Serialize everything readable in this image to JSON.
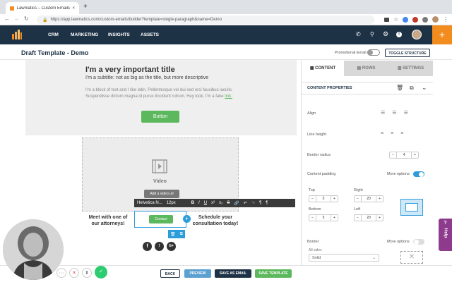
{
  "browser": {
    "tab_title": "Lawmatics – Custom Emails – B",
    "url": "https://app.lawmatics.com/custom-emails/builder?template=single-paragraph&name=Demo"
  },
  "nav": {
    "items": [
      "CRM",
      "MARKETING",
      "INSIGHTS",
      "ASSETS"
    ],
    "plus": "+"
  },
  "header": {
    "title": "Draft Template - Demo",
    "promotional_label": "Promotional Email",
    "toggle_structure": "TOGGLE STRUCTURE"
  },
  "email": {
    "title": "I'm a very important title",
    "subtitle": "I'm a subtitle: not as big as the title, but more descriptive",
    "body": "I'm a block of text and I like latin. Pellentesque vel dui sed orci faucibus iaculis. Suspendisse dictum magna id purus tincidunt rutrum. Hey look, I'm a fake",
    "link_text": "link.",
    "button": "Button",
    "video_label": "Video",
    "add_video": "Add a video url",
    "left_text": "Meet with one of our attorneys!",
    "right_text": "Schedule your consultation today!",
    "cta": "Contact"
  },
  "toolbar": {
    "font": "Helvetica N...",
    "size": "12px"
  },
  "panel": {
    "tabs": [
      "CONTENT",
      "ROWS",
      "SETTINGS"
    ],
    "section": "CONTENT PROPERTIES",
    "align": "Align",
    "line_height": "Line height",
    "border_radius": "Border radius",
    "border_radius_value": "4",
    "content_padding": "Content padding",
    "more_options": "More options",
    "top": "Top",
    "right": "Right",
    "bottom": "Bottom",
    "left": "Left",
    "top_value": "5",
    "right_value": "20",
    "bottom_value": "5",
    "left_value": "20",
    "border": "Border",
    "border_more": "More options",
    "all_sides": "All sides",
    "solid": "Solid",
    "help": "Help"
  },
  "footer": {
    "back": "BACK",
    "preview": "PREVIEW",
    "save_as_email": "SAVE AS EMAIL",
    "save_template": "SAVE TEMPLATE"
  },
  "colors": {
    "nav": "#1e3246",
    "orange": "#f28c1e",
    "green": "#5cb85c",
    "blue": "#2d9cdb",
    "purple": "#8e3b8e"
  }
}
